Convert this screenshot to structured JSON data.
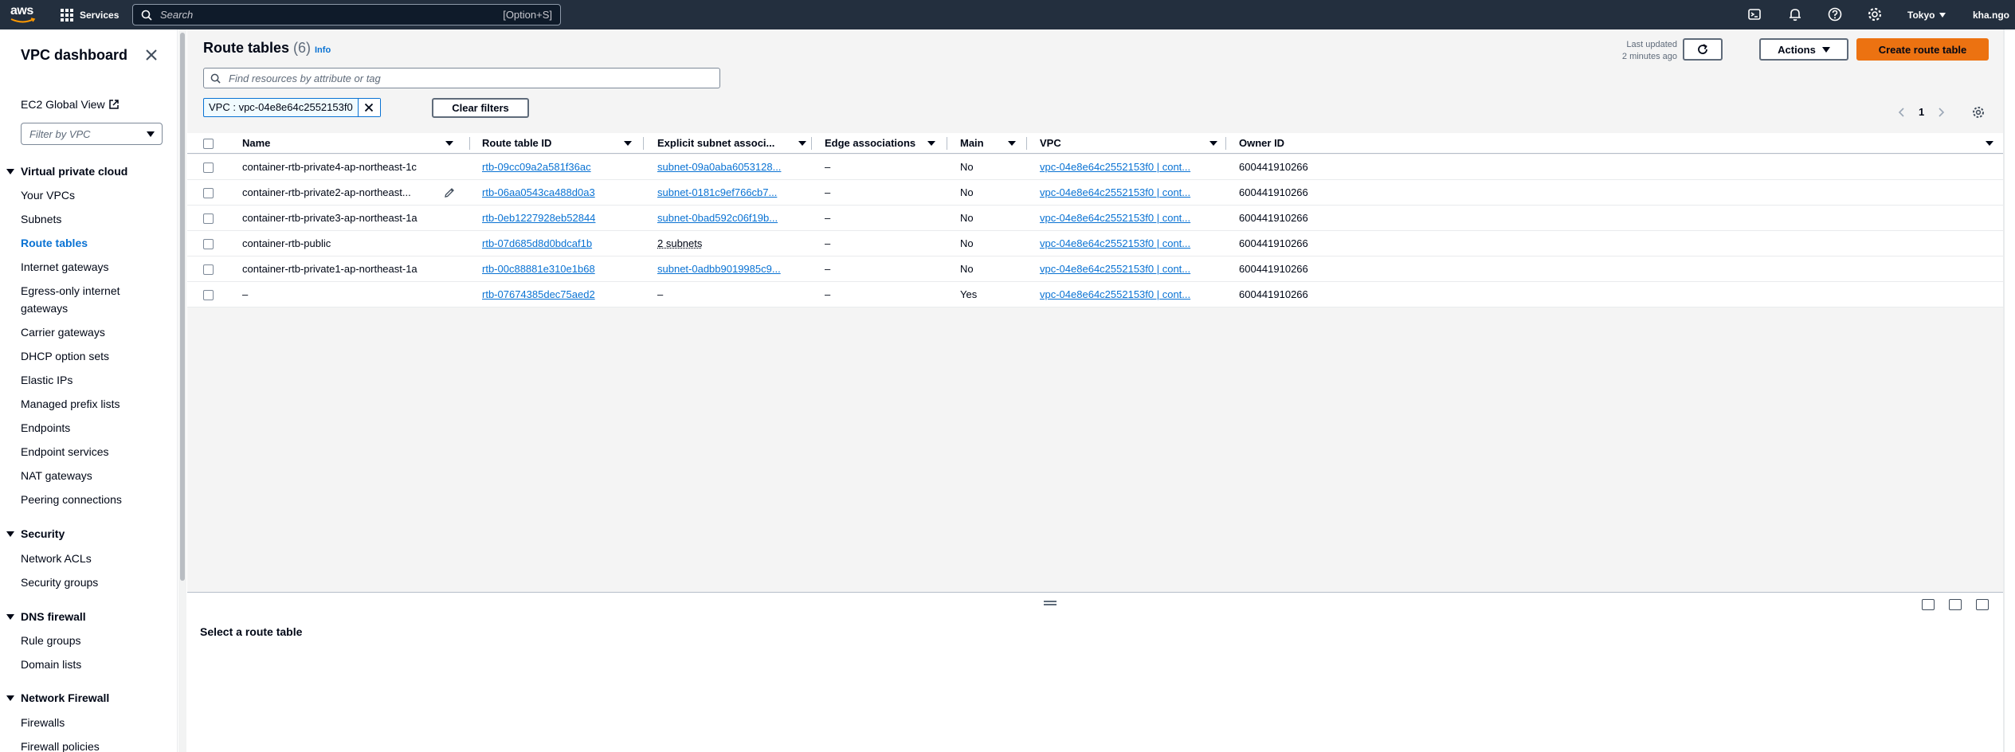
{
  "topnav": {
    "logo_text": "aws",
    "services_label": "Services",
    "search_placeholder": "Search",
    "search_shortcut": "[Option+S]",
    "region_label": "Tokyo",
    "user_label": "kha.ngo"
  },
  "sidebar": {
    "title": "VPC dashboard",
    "ec2_global_view": "EC2 Global View",
    "vpc_filter_placeholder": "Filter by VPC",
    "sections": [
      {
        "label": "Virtual private cloud",
        "items": [
          "Your VPCs",
          "Subnets",
          "Route tables",
          "Internet gateways",
          "Egress-only internet",
          "gateways",
          "Carrier gateways",
          "DHCP option sets",
          "Elastic IPs",
          "Managed prefix lists",
          "Endpoints",
          "Endpoint services",
          "NAT gateways",
          "Peering connections"
        ]
      },
      {
        "label": "Security",
        "items": [
          "Network ACLs",
          "Security groups"
        ]
      },
      {
        "label": "DNS firewall",
        "items": [
          "Rule groups",
          "Domain lists"
        ]
      },
      {
        "label": "Network Firewall",
        "items": [
          "Firewalls",
          "Firewall policies"
        ]
      }
    ],
    "active_item": "Route tables"
  },
  "main": {
    "title": "Route tables",
    "count": "(6)",
    "info_label": "Info",
    "last_updated_line1": "Last updated",
    "last_updated_line2": "2 minutes ago",
    "actions_label": "Actions",
    "create_label": "Create route table",
    "filter_placeholder": "Find resources by attribute or tag",
    "filter_token": "VPC : vpc-04e8e64c2552153f0",
    "clear_filters_label": "Clear filters",
    "current_page": "1"
  },
  "table": {
    "columns": [
      "Name",
      "Route table ID",
      "Explicit subnet associ...",
      "Edge associations",
      "Main",
      "VPC",
      "Owner ID"
    ],
    "rows": [
      {
        "name": "container-rtb-private4-ap-northeast-1c",
        "rtb": "rtb-09cc09a2a581f36ac",
        "subnet": "subnet-09a0aba6053128...",
        "edge": "–",
        "main": "No",
        "vpc": "vpc-04e8e64c2552153f0 | cont...",
        "owner": "600441910266"
      },
      {
        "name": "container-rtb-private2-ap-northeast...",
        "rtb": "rtb-06aa0543ca488d0a3",
        "subnet": "subnet-0181c9ef766cb7...",
        "edge": "–",
        "main": "No",
        "vpc": "vpc-04e8e64c2552153f0 | cont...",
        "owner": "600441910266"
      },
      {
        "name": "container-rtb-private3-ap-northeast-1a",
        "rtb": "rtb-0eb1227928eb52844",
        "subnet": "subnet-0bad592c06f19b...",
        "edge": "–",
        "main": "No",
        "vpc": "vpc-04e8e64c2552153f0 | cont...",
        "owner": "600441910266"
      },
      {
        "name": "container-rtb-public",
        "rtb": "rtb-07d685d8d0bdcaf1b",
        "subnet": "2 subnets",
        "edge": "–",
        "main": "No",
        "vpc": "vpc-04e8e64c2552153f0 | cont...",
        "owner": "600441910266"
      },
      {
        "name": "container-rtb-private1-ap-northeast-1a",
        "rtb": "rtb-00c88881e310e1b68",
        "subnet": "subnet-0adbb9019985c9...",
        "edge": "–",
        "main": "No",
        "vpc": "vpc-04e8e64c2552153f0 | cont...",
        "owner": "600441910266"
      },
      {
        "name": "–",
        "rtb": "rtb-07674385dec75aed2",
        "subnet": "–",
        "edge": "–",
        "main": "Yes",
        "vpc": "vpc-04e8e64c2552153f0 | cont...",
        "owner": "600441910266"
      }
    ]
  },
  "split_panel": {
    "title": "Select a route table"
  },
  "colors": {
    "nav_bg": "#232f3e",
    "link": "#0972d3",
    "primary_button": "#ec7211"
  }
}
